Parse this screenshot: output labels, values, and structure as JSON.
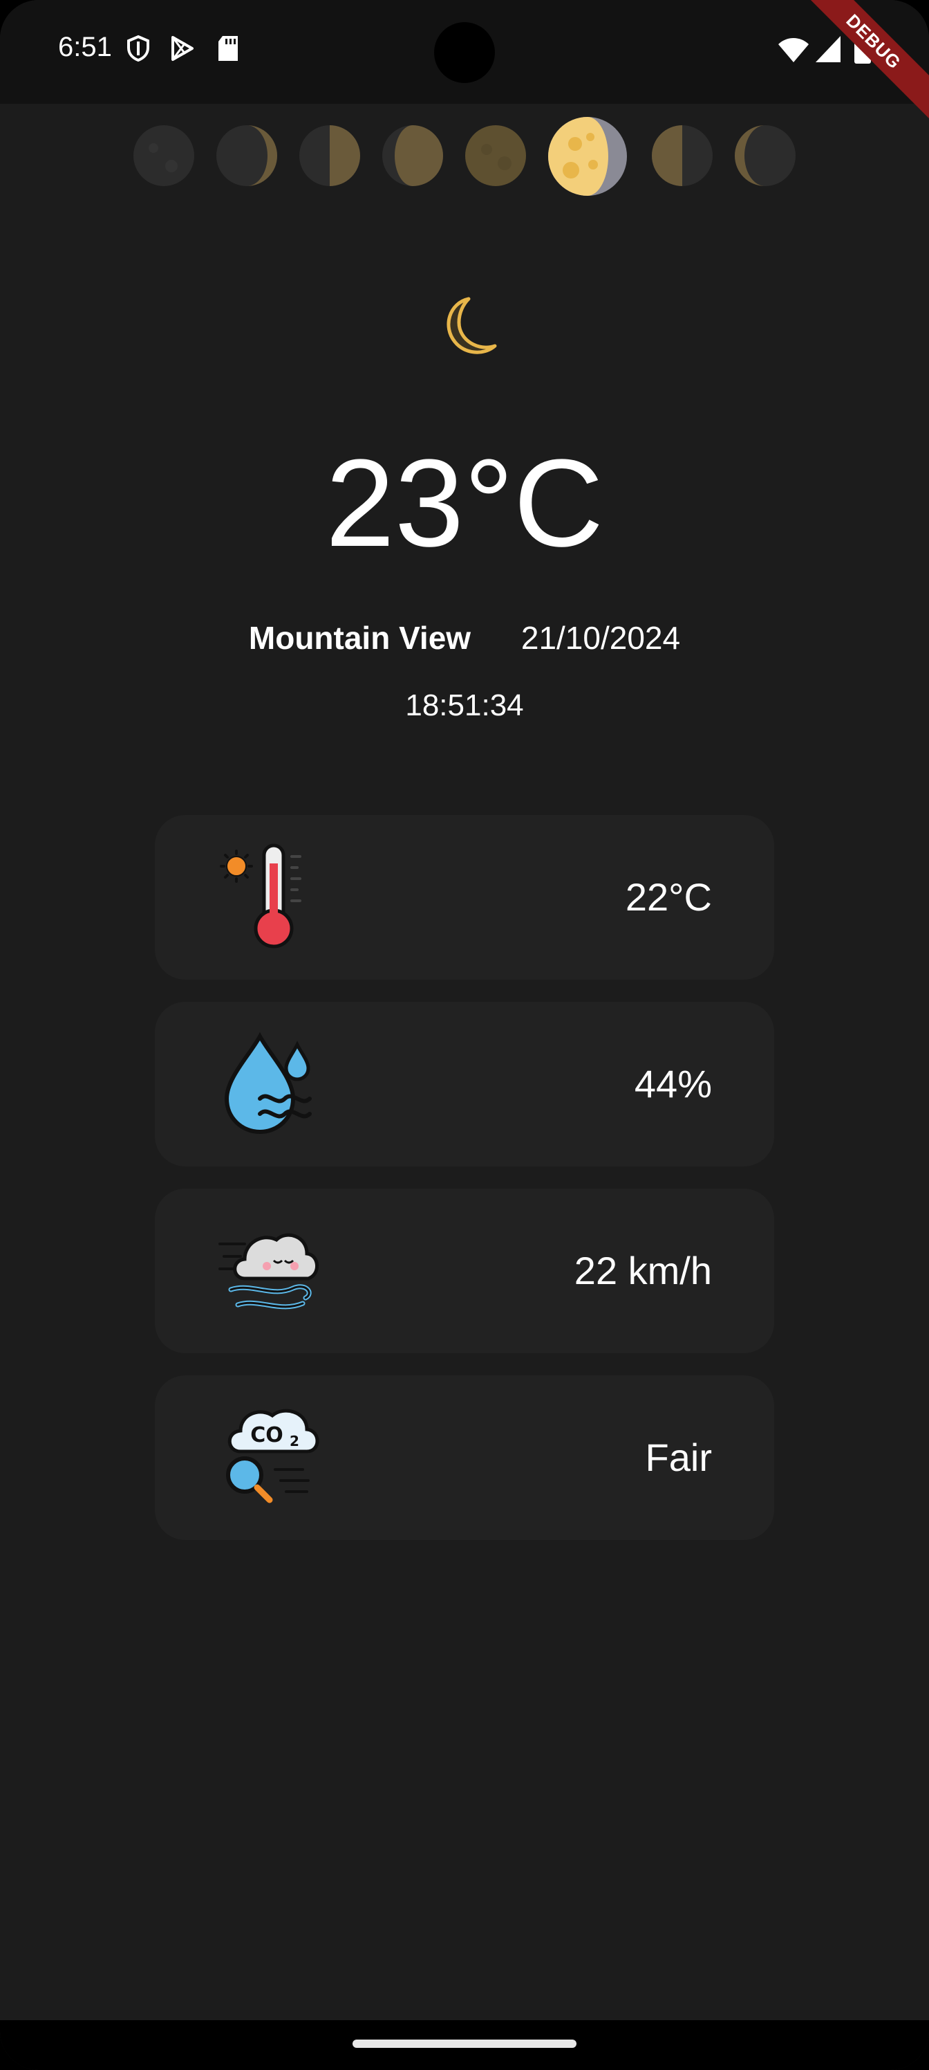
{
  "status_bar": {
    "time": "6:51",
    "left_icons": [
      "shield-icon",
      "play-store-icon",
      "sd-card-icon"
    ],
    "right_icons": [
      "wifi-icon",
      "signal-icon",
      "battery-icon"
    ],
    "debug_label": "DEBUG"
  },
  "moon_phases": {
    "icons": [
      "new-moon-icon",
      "waxing-crescent-icon",
      "first-quarter-icon",
      "waxing-gibbous-icon",
      "full-moon-icon",
      "waning-gibbous-icon",
      "last-quarter-icon",
      "waning-crescent-icon"
    ],
    "selected_index": 5
  },
  "weather": {
    "condition_icon": "crescent-moon-icon",
    "temperature": "23°C",
    "location": "Mountain View",
    "date": "21/10/2024",
    "time": "18:51:34"
  },
  "cards": [
    {
      "icon": "thermometer-sun-icon",
      "value": "22°C"
    },
    {
      "icon": "humidity-drop-icon",
      "value": "44%"
    },
    {
      "icon": "wind-cloud-icon",
      "value": "22 km/h"
    },
    {
      "icon": "air-quality-co2-icon",
      "value": "Fair"
    }
  ],
  "colors": {
    "background": "#1c1c1c",
    "card": "#222222",
    "moon_accent": "#e8b64a",
    "status_bar": "#121212"
  }
}
